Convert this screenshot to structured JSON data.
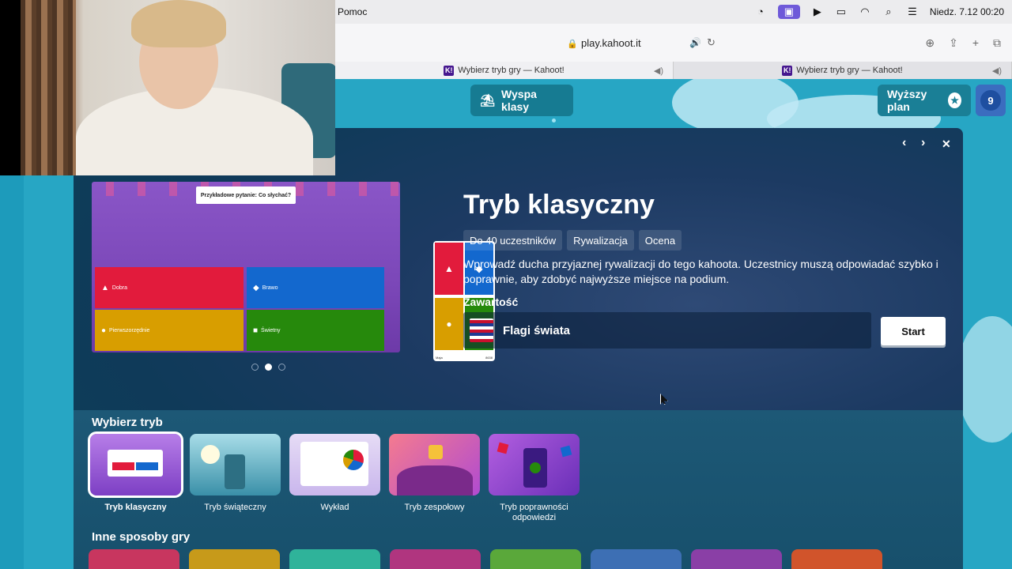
{
  "menubar": {
    "app_menu": "Pomoc",
    "datetime": "Niedz. 7.12  00:20"
  },
  "browser": {
    "url": "play.kahoot.it",
    "tabs": [
      {
        "title": "Wybierz tryb gry — Kahoot!",
        "active": true
      },
      {
        "title": "Wybierz tryb gry — Kahoot!",
        "active": false
      }
    ]
  },
  "topbar": {
    "island_label": "Wyspa klasy",
    "upgrade_label": "Wyższy plan",
    "avatar_initial": "9"
  },
  "preview": {
    "question": "Przykładowe pytanie: Co słychać?",
    "answers": [
      "Dobra",
      "Brawo",
      "Pierwszorzędnie",
      "Świetny"
    ],
    "phone_left": "Maja",
    "phone_right": "8638",
    "carousel_count": 3,
    "carousel_active": 1
  },
  "mode": {
    "title": "Tryb klasyczny",
    "tags": [
      "Do 40 uczestników",
      "Rywalizacja",
      "Ocena"
    ],
    "description": "Wprowadź ducha przyjaznej rywalizacji do tego kahoota. Uczestnicy muszą odpowiadać szybko i poprawnie, aby zdobyć najwyższe miejsce na podium.",
    "content_label": "Zawartość",
    "content_name": "Flagi świata",
    "start_label": "Start"
  },
  "choose_mode": {
    "title": "Wybierz tryb",
    "modes": [
      {
        "label": "Tryb klasyczny",
        "selected": true
      },
      {
        "label": "Tryb świąteczny",
        "selected": false
      },
      {
        "label": "Wykład",
        "selected": false
      },
      {
        "label": "Tryb zespołowy",
        "selected": false
      },
      {
        "label": "Tryb poprawności odpowiedzi",
        "selected": false
      }
    ]
  },
  "other_ways": {
    "title": "Inne sposoby gry"
  },
  "colors": {
    "kahoot_red": "#e21b3c",
    "kahoot_blue": "#1368ce",
    "kahoot_yellow": "#d89e00",
    "kahoot_green": "#26890c",
    "page_bg": "#27a6c4"
  }
}
